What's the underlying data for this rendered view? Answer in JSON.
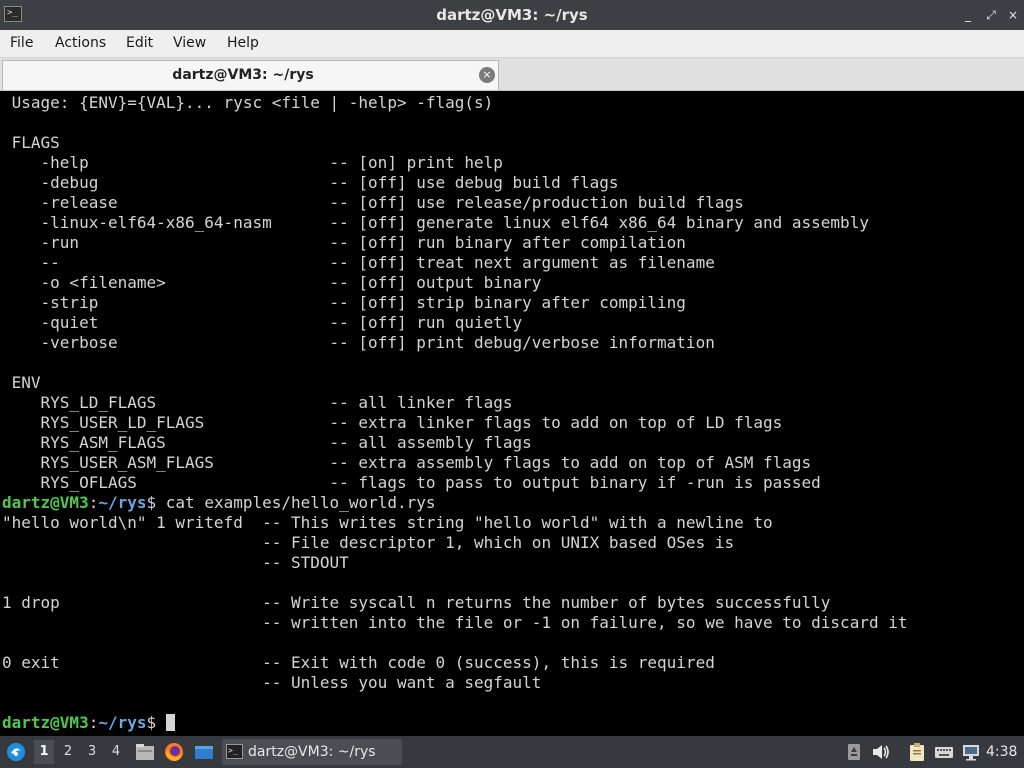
{
  "window": {
    "title": "dartz@VM3: ~/rys",
    "controls": [
      "_",
      "⤢",
      "×"
    ]
  },
  "menu": [
    "File",
    "Actions",
    "Edit",
    "View",
    "Help"
  ],
  "tab": {
    "label": "dartz@VM3: ~/rys",
    "close": "×"
  },
  "terminal": {
    "prompt_user": "dartz@VM3",
    "prompt_path": "~/rys",
    "lines": [
      {
        "type": "text",
        "text": " Usage: {ENV}={VAL}... rysc <file | -help> -flag(s)"
      },
      {
        "type": "text",
        "text": ""
      },
      {
        "type": "text",
        "text": " FLAGS"
      },
      {
        "type": "text",
        "text": "    -help                         -- [on] print help"
      },
      {
        "type": "text",
        "text": "    -debug                        -- [off] use debug build flags"
      },
      {
        "type": "text",
        "text": "    -release                      -- [off] use release/production build flags"
      },
      {
        "type": "text",
        "text": "    -linux-elf64-x86_64-nasm      -- [off] generate linux elf64 x86_64 binary and assembly"
      },
      {
        "type": "text",
        "text": "    -run                          -- [off] run binary after compilation"
      },
      {
        "type": "text",
        "text": "    --                            -- [off] treat next argument as filename"
      },
      {
        "type": "text",
        "text": "    -o <filename>                 -- [off] output binary"
      },
      {
        "type": "text",
        "text": "    -strip                        -- [off] strip binary after compiling"
      },
      {
        "type": "text",
        "text": "    -quiet                        -- [off] run quietly"
      },
      {
        "type": "text",
        "text": "    -verbose                      -- [off] print debug/verbose information"
      },
      {
        "type": "text",
        "text": ""
      },
      {
        "type": "text",
        "text": " ENV"
      },
      {
        "type": "text",
        "text": "    RYS_LD_FLAGS                  -- all linker flags"
      },
      {
        "type": "text",
        "text": "    RYS_USER_LD_FLAGS             -- extra linker flags to add on top of LD flags"
      },
      {
        "type": "text",
        "text": "    RYS_ASM_FLAGS                 -- all assembly flags"
      },
      {
        "type": "text",
        "text": "    RYS_USER_ASM_FLAGS            -- extra assembly flags to add on top of ASM flags"
      },
      {
        "type": "text",
        "text": "    RYS_OFLAGS                    -- flags to pass to output binary if -run is passed"
      },
      {
        "type": "prompt",
        "cmd": " cat examples/hello_world.rys"
      },
      {
        "type": "text",
        "text": "\"hello world\\n\" 1 writefd  -- This writes string \"hello world\" with a newline to"
      },
      {
        "type": "text",
        "text": "                           -- File descriptor 1, which on UNIX based OSes is"
      },
      {
        "type": "text",
        "text": "                           -- STDOUT"
      },
      {
        "type": "text",
        "text": ""
      },
      {
        "type": "text",
        "text": "1 drop                     -- Write syscall n returns the number of bytes successfully"
      },
      {
        "type": "text",
        "text": "                           -- written into the file or -1 on failure, so we have to discard it"
      },
      {
        "type": "text",
        "text": ""
      },
      {
        "type": "text",
        "text": "0 exit                     -- Exit with code 0 (success), this is required"
      },
      {
        "type": "text",
        "text": "                           -- Unless you want a segfault"
      },
      {
        "type": "text",
        "text": ""
      },
      {
        "type": "prompt",
        "cmd": " ",
        "cursor": true
      }
    ]
  },
  "taskbar": {
    "workspaces": [
      "1",
      "2",
      "3",
      "4"
    ],
    "active_workspace": "1",
    "launcher_icons": [
      "start-menu-icon",
      "file-manager-icon",
      "firefox-icon",
      "show-desktop-icon"
    ],
    "task_label": "dartz@VM3: ~/rys",
    "tray_icons": [
      "removable-media-icon",
      "volume-icon",
      "clipboard-icon",
      "keyboard-icon",
      "network-icon"
    ],
    "clock": "4:38"
  },
  "colors": {
    "prompt_user": "#4ec94e",
    "prompt_path": "#6ea7e0",
    "terminal_bg": "#000000",
    "terminal_fg": "#d4d4d4"
  }
}
